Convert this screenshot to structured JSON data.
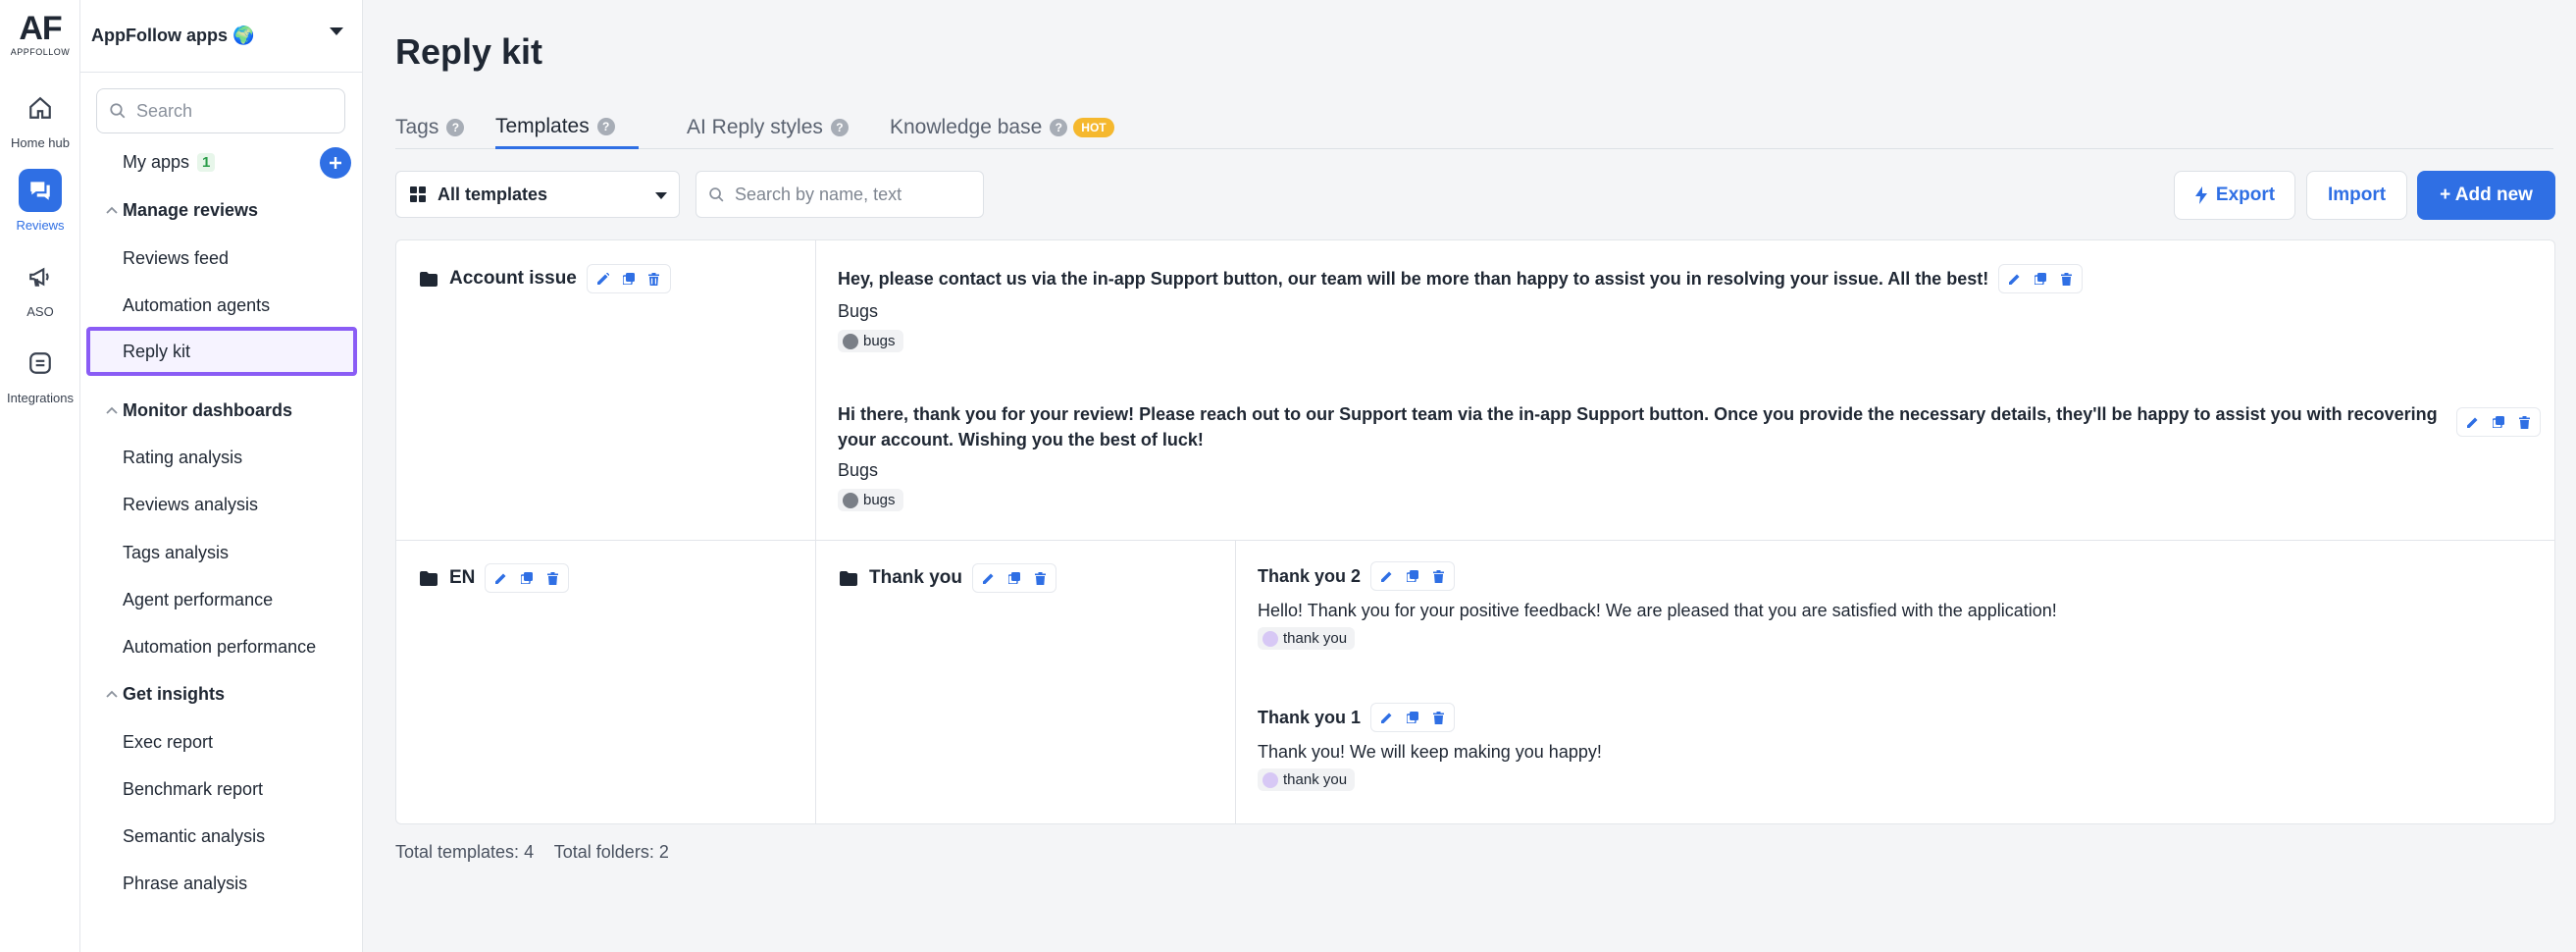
{
  "rail": {
    "logo_main": "AF",
    "logo_sub": "APPFOLLOW",
    "items": [
      {
        "label": "Home hub",
        "icon": "home-icon"
      },
      {
        "label": "Reviews",
        "icon": "reviews-icon"
      },
      {
        "label": "ASO",
        "icon": "megaphone-icon"
      },
      {
        "label": "Integrations",
        "icon": "integrations-icon"
      }
    ]
  },
  "sidebar": {
    "account": "AppFollow apps 🌍",
    "search_placeholder": "Search",
    "my_apps": {
      "label": "My apps",
      "count": "1"
    },
    "sections": [
      {
        "title": "Manage reviews",
        "items": [
          "Reviews feed",
          "Automation agents",
          "Reply kit"
        ]
      },
      {
        "title": "Monitor dashboards",
        "items": [
          "Rating analysis",
          "Reviews analysis",
          "Tags analysis",
          "Agent performance",
          "Automation performance"
        ]
      },
      {
        "title": "Get insights",
        "items": [
          "Exec report",
          "Benchmark report",
          "Semantic analysis",
          "Phrase analysis"
        ]
      }
    ]
  },
  "main": {
    "title": "Reply kit",
    "tabs": [
      {
        "label": "Tags"
      },
      {
        "label": "Templates"
      },
      {
        "label": "AI Reply styles"
      },
      {
        "label": "Knowledge base",
        "badge": "HOT"
      }
    ],
    "filter_label": "All templates",
    "search_placeholder": "Search by name, text",
    "buttons": {
      "export": "Export",
      "import": "Import",
      "add_new": "+ Add new"
    },
    "folders": [
      {
        "name": "Account issue",
        "templates": [
          {
            "title": "Hey, please contact us via the in-app Support button, our team will be more than happy to assist you in resolving your issue. All the best!",
            "subtitle": "Bugs",
            "tag": "bugs"
          },
          {
            "title": "Hi there, thank you for your review! Please reach out to our Support team via the in-app Support button. Once you provide the necessary details, they'll be happy to assist you with recovering your account. Wishing you the best of luck!",
            "subtitle": "Bugs",
            "tag": "bugs"
          }
        ]
      },
      {
        "name": "EN",
        "subfolder": "Thank you",
        "templates": [
          {
            "title": "Thank you 2",
            "body": "Hello! Thank you for your positive feedback! We are pleased that you are satisfied with the application!",
            "tag": "thank you"
          },
          {
            "title": "Thank you 1",
            "body": "Thank you! We will keep making you happy!",
            "tag": "thank you"
          }
        ]
      }
    ],
    "footer": {
      "templates": "Total templates: 4",
      "folders": "Total folders: 2"
    }
  },
  "colors": {
    "accent": "#2f6fe4",
    "highlight": "#8a5cf5",
    "tag_bugs": "#7a7f87",
    "tag_thanks": "#d7c8f5"
  }
}
